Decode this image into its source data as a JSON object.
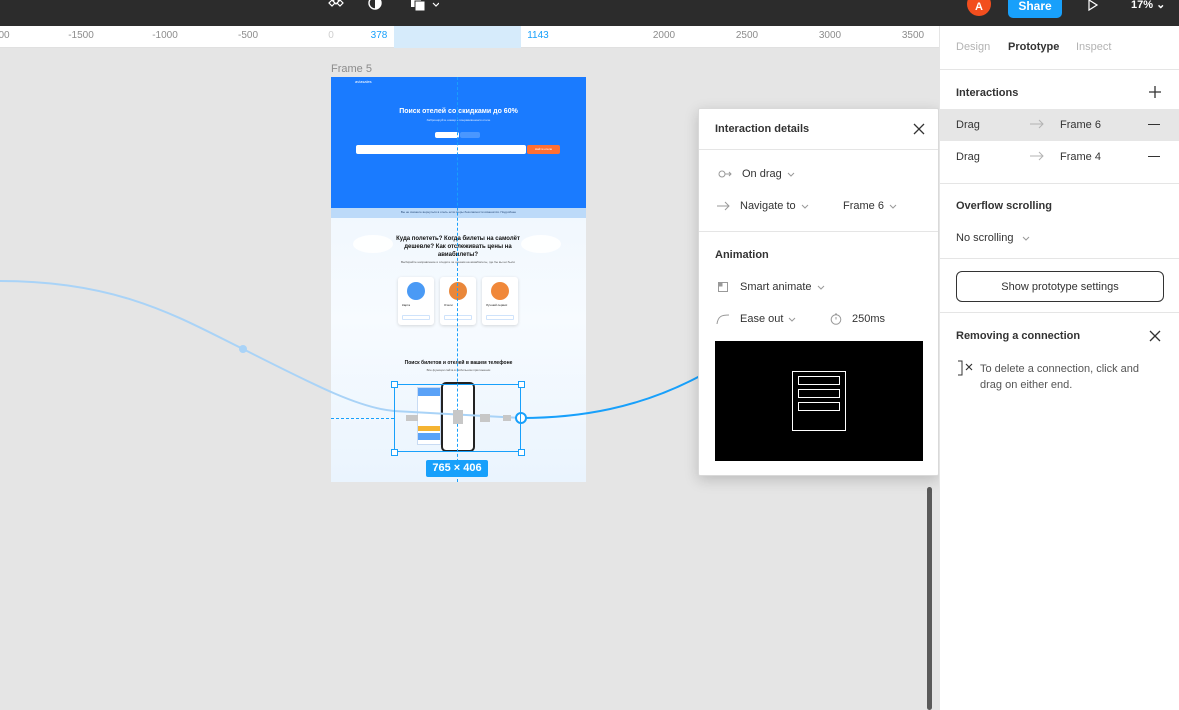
{
  "topbar": {
    "avatar_initial": "A",
    "share_label": "Share",
    "zoom": "17%",
    "icons": [
      "components-icon",
      "contrast-icon",
      "boolean-icon",
      "play-icon"
    ]
  },
  "ruler": {
    "ticks": [
      "00",
      "-1500",
      "-1000",
      "-500",
      "0",
      "378",
      "1143",
      "2000",
      "2500",
      "3000",
      "3500"
    ]
  },
  "canvas": {
    "frame_label": "Frame 5",
    "selection_size": "765 × 406",
    "frame_content": {
      "logo": "aviasales",
      "hero_title": "Поиск отелей со скидками до 60%",
      "hero_subtitle": "Забронируйте номер в понравившемся отеле",
      "search_button": "Найти отели",
      "band_text": "Вы не сможете вернуться в отель если меры безопасности изменятся. Подробнее",
      "section_title": "Куда полететь? Когда билеты на самолёт дешевле? Как отслеживать цены на авиабилеты?",
      "section_text": "Выбирайте направление и следите за ценами на авиабилеты, где бы вы ни были",
      "cards": [
        "Карта",
        "Отели",
        "Лучший сервис"
      ],
      "app_title": "Поиск билетов и отелей в вашем телефоне",
      "app_text": "Все функции сайта в мобильном приложении"
    }
  },
  "popup": {
    "title": "Interaction details",
    "trigger": "On drag",
    "action": "Navigate to",
    "destination": "Frame 6",
    "animation_title": "Animation",
    "animation_type": "Smart animate",
    "easing": "Ease out",
    "duration": "250ms"
  },
  "panel": {
    "tabs": [
      "Design",
      "Prototype",
      "Inspect"
    ],
    "active_tab": "Prototype",
    "interactions_title": "Interactions",
    "interactions": [
      {
        "trigger": "Drag",
        "destination": "Frame 6"
      },
      {
        "trigger": "Drag",
        "destination": "Frame 4"
      }
    ],
    "overflow_title": "Overflow scrolling",
    "overflow_value": "No scrolling",
    "settings_button": "Show prototype settings",
    "removing_title": "Removing a connection",
    "removing_text": "To delete a connection, click and drag on either end."
  },
  "colors": {
    "accent": "#18a0fb",
    "avatar": "#f24e1e",
    "topbar": "#2c2c2c",
    "canvas": "#e5e5e5"
  }
}
